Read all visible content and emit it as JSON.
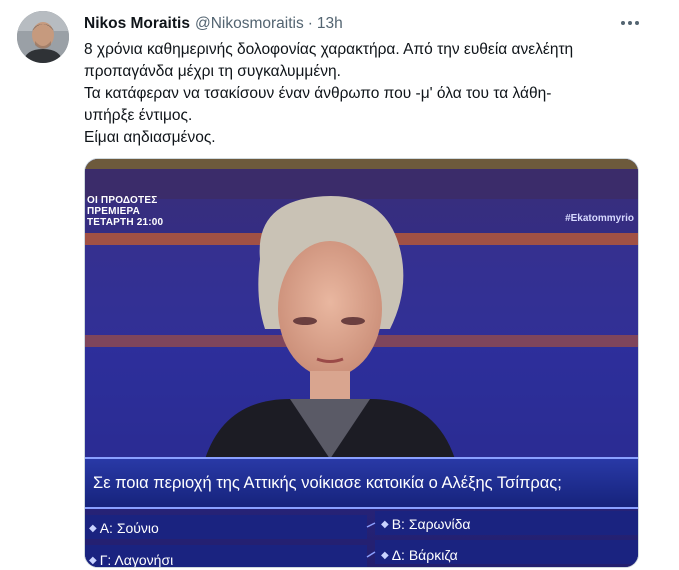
{
  "tweet": {
    "display_name": "Nikos Moraitis",
    "handle": "@Nikosmoraitis",
    "separator": "·",
    "time": "13h",
    "more_icon": "more-horizontal-icon",
    "text_lines": [
      "8 χρόνια καθημερινής δολοφονίας χαρακτήρα. Από την ευθεία ανελέητη",
      "προπαγάνδα μέχρι τη συγκαλυμμένη.",
      "Τα κατάφεραν να τσακίσουν έναν άνθρωπο που -μ' όλα του τα λάθη-",
      "υπήρξε έντιμος.",
      "Είμαι αηδιασμένος."
    ]
  },
  "media": {
    "tv_promo_lines": [
      "ΟΙ ΠΡΟΔΟΤΕΣ",
      "ΠΡΕΜΙΕΡΑ",
      "ΤΕΤΑΡΤΗ 21:00"
    ],
    "hashtag": "#Ekatommyrio",
    "question": "Σε ποια περιοχή της Αττικής νοίκιασε κατοικία ο Αλέξης Τσίπρας;",
    "answers": {
      "a": "Α: Σούνιο",
      "b": "Β: Σαρωνίδα",
      "c": "Γ: Λαγονήσι",
      "d": "Δ: Βάρκιζα"
    },
    "colors": {
      "studio_blue": "#2b2a8a",
      "banner_blue": "#1b2a8c",
      "accent_orange": "#d9763a"
    }
  }
}
